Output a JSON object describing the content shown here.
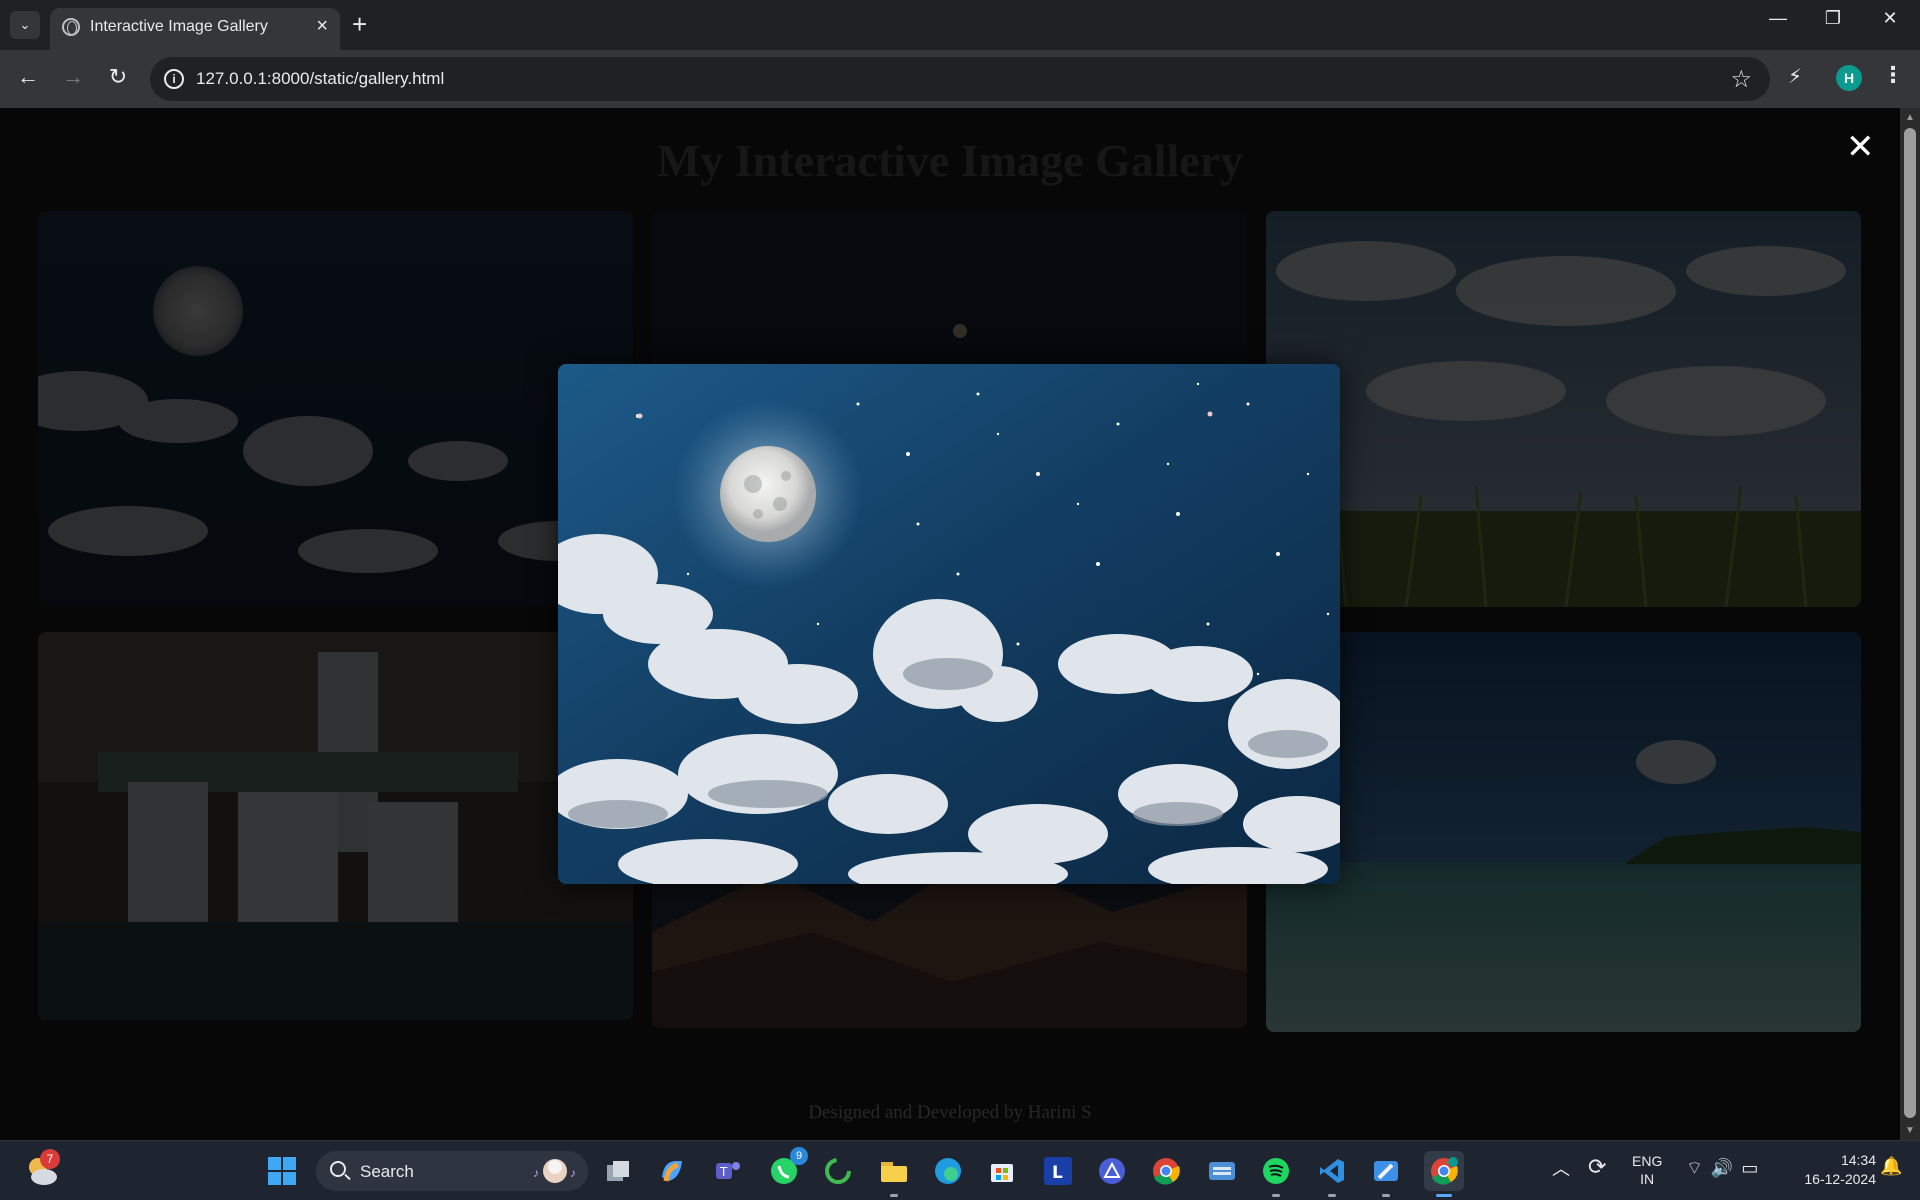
{
  "browser": {
    "tab_title": "Interactive Image Gallery",
    "url": "127.0.0.1:8000/static/gallery.html",
    "profile_initial": "H"
  },
  "page": {
    "title": "My Interactive Image Gallery",
    "footer": "Designed and Developed by Harini S",
    "close_symbol": "✕",
    "thumbnails": [
      {
        "subject": "moon-night-sky"
      },
      {
        "subject": "dark-sky-moon"
      },
      {
        "subject": "cloudy-sky-field"
      },
      {
        "subject": "waterfall"
      },
      {
        "subject": "mountains"
      },
      {
        "subject": "tropical-beach"
      }
    ],
    "lightbox_subject": "full-moon-starry-sky-clouds"
  },
  "taskbar": {
    "search_label": "Search",
    "weather_badge": "7",
    "whatsapp_badge": "9",
    "lang_line1": "ENG",
    "lang_line2": "IN",
    "time": "14:34",
    "date": "16-12-2024"
  },
  "colors": {
    "page_bg": "#0d0d0e",
    "chrome_bg": "#202124",
    "toolbar_bg": "#35363a",
    "taskbar_bg": "#1f2530",
    "profile": "#0a9b8e"
  }
}
